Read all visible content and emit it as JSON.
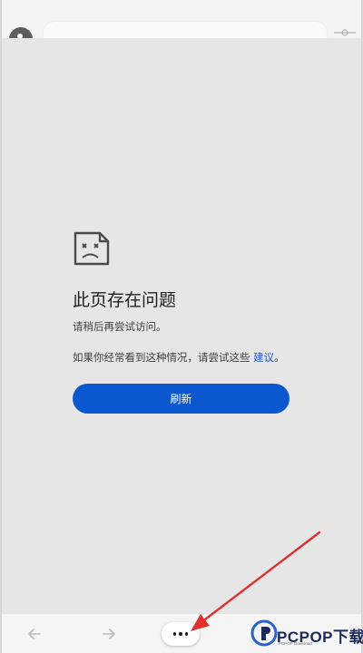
{
  "browser": {
    "avatar_icon": "profile-icon",
    "slider_icon": "slider-icon",
    "back_icon": "arrow-left-icon",
    "forward_icon": "arrow-right-icon",
    "more_icon": "more-dots-icon"
  },
  "error_page": {
    "icon": "sad-page-icon",
    "title": "此页存在问题",
    "line1": "请稍后再尝试访问。",
    "line2_prefix": "如果你经常看到这种情况，请尝试这些 ",
    "line2_link": "建议",
    "line2_suffix": "。",
    "refresh_label": "刷新"
  },
  "watermark": {
    "brand": "PCPOP下载",
    "sub": "PCPOP Download"
  },
  "colors": {
    "accent": "#0b57d0",
    "link": "#1a56d6",
    "annotation": "#e03030",
    "page_bg": "#e6e6e6"
  }
}
